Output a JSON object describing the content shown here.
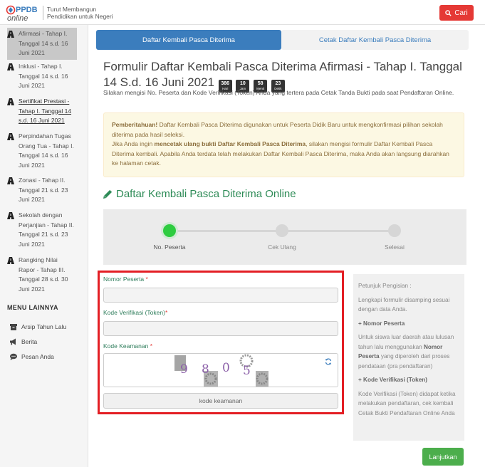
{
  "header": {
    "logo_text": "PPDB online",
    "tagline_1": "Turut Membangun",
    "tagline_2": "Pendidikan untuk Negeri",
    "search_label": "Cari"
  },
  "sidebar": {
    "items": [
      {
        "label": "Afirmasi - Tahap I. Tanggal 14 s.d. 16 Juni 2021",
        "active": true
      },
      {
        "label": "Inklusi - Tahap I. Tanggal 14 s.d. 16 Juni 2021"
      },
      {
        "label": "Sertifikat Prestasi - Tahap I. Tanggal 14 s.d. 16 Juni 2021"
      },
      {
        "label": "Perpindahan Tugas Orang Tua - Tahap I. Tanggal 14 s.d. 16 Juni 2021"
      },
      {
        "label": "Zonasi - Tahap II. Tanggal 21 s.d. 23 Juni 2021"
      },
      {
        "label": "Sekolah dengan Perjanjian - Tahap II. Tanggal 21 s.d. 23 Juni 2021"
      },
      {
        "label": "Rangking Nilai Rapor - Tahap III. Tanggal 28 s.d. 30 Juni 2021"
      }
    ],
    "menu_heading": "MENU LAINNYA",
    "menu": [
      {
        "label": "Arsip Tahun Lalu",
        "icon": "archive-icon"
      },
      {
        "label": "Berita",
        "icon": "bullhorn-icon"
      },
      {
        "label": "Pesan Anda",
        "icon": "chat-icon"
      }
    ]
  },
  "tabs": {
    "active": "Daftar Kembali Pasca Diterima",
    "other": "Cetak Daftar Kembali Pasca Diterima"
  },
  "page": {
    "title": "Formulir Daftar Kembali Pasca Diterima Afirmasi - Tahap I. Tanggal 14 S.d. 16 Juni 2021",
    "countdown": [
      {
        "value": "386",
        "unit": "Hari"
      },
      {
        "value": "10",
        "unit": "Jam"
      },
      {
        "value": "58",
        "unit": "Menit"
      },
      {
        "value": "23",
        "unit": "Detik"
      }
    ],
    "intro": "Silakan mengisi No. Peserta dan Kode Verifikasi (Token) Anda yang tertera pada Cetak Tanda Bukti pada saat Pendaftaran Online."
  },
  "notice": {
    "strong": "Pemberitahuan!",
    "line1": " Daftar Kembali Pasca Diterima digunakan untuk Peserta Didik Baru untuk mengkonfirmasi pilihan sekolah diterima pada hasil seleksi.",
    "line2a": "Jika Anda ingin ",
    "line2b": "mencetak ulang bukti Daftar Kembali Pasca Diterima",
    "line2c": ", silakan mengisi formulir Daftar Kembali Pasca Diterima kembali. Apabila Anda terdata telah melakukan Daftar Kembali Pasca Diterima, maka Anda akan langsung diarahkan ke halaman cetak."
  },
  "section_title": "Daftar Kembali Pasca Diterima Online",
  "steps": [
    "No. Peserta",
    "Cek Ulang",
    "Selesai"
  ],
  "form": {
    "nomor_label": "Nomor Peserta",
    "kode_label": "Kode Verifikasi (Token)",
    "keamanan_label": "Kode Keamanan",
    "required_mark": "*",
    "captcha_digits": [
      "9",
      "8",
      "0",
      "5"
    ],
    "captcha_button": "kode keamanan"
  },
  "hint": {
    "title": "Petunjuk Pengisian :",
    "text": "Lengkapi formulir disamping sesuai dengan data Anda.",
    "nomor_head": "+ Nomor Peserta",
    "nomor_a": "Untuk siswa luar daerah atau lulusan tahun lalu menggunakan ",
    "nomor_b": "Nomor Peserta",
    "nomor_c": " yang diperoleh dari proses pendataan (pra pendaftaran)",
    "kode_head": "+ Kode Verifikasi (Token)",
    "kode_text": "Kode Verifikasi (Token) didapat ketika melakukan pendaftaran, cek kembali Cetak Bukti Pendaftaran Online Anda"
  },
  "next_label": "Lanjutkan",
  "colors": {
    "primary": "#3b7dbd",
    "success": "#4cae4c",
    "danger": "#e53935",
    "section": "#2e8b57",
    "highlight_border": "#e31e24"
  }
}
